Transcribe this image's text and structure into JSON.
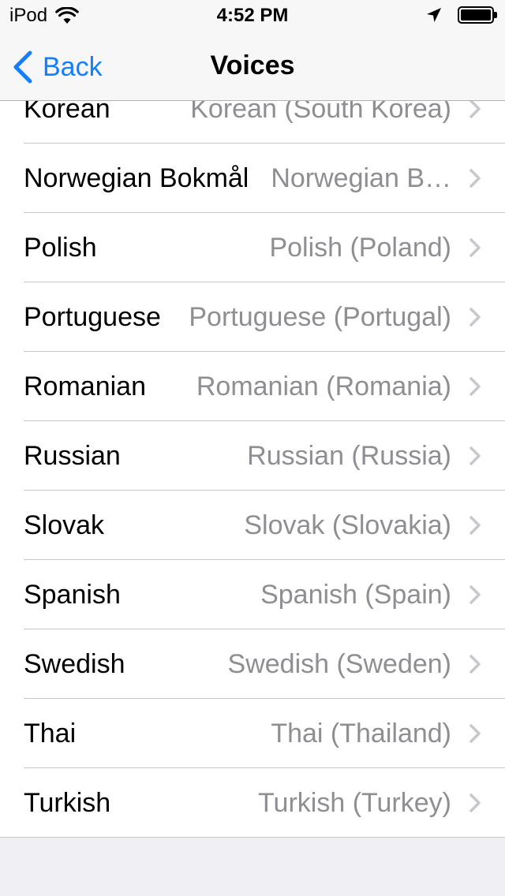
{
  "status_bar": {
    "carrier": "iPod",
    "time": "4:52 PM",
    "icons": [
      "wifi-icon",
      "location-arrow-icon",
      "battery-icon"
    ]
  },
  "nav": {
    "back_label": "Back",
    "title": "Voices"
  },
  "colors": {
    "accent": "#157efb",
    "detail_text": "#8e8e93",
    "background": "#efeff4"
  },
  "voices": [
    {
      "language": "Korean",
      "voice": "Korean (South Korea)"
    },
    {
      "language": "Norwegian Bokmål",
      "voice": "Norwegian B…"
    },
    {
      "language": "Polish",
      "voice": "Polish (Poland)"
    },
    {
      "language": "Portuguese",
      "voice": "Portuguese (Portugal)"
    },
    {
      "language": "Romanian",
      "voice": "Romanian (Romania)"
    },
    {
      "language": "Russian",
      "voice": "Russian (Russia)"
    },
    {
      "language": "Slovak",
      "voice": "Slovak (Slovakia)"
    },
    {
      "language": "Spanish",
      "voice": "Spanish (Spain)"
    },
    {
      "language": "Swedish",
      "voice": "Swedish (Sweden)"
    },
    {
      "language": "Thai",
      "voice": "Thai (Thailand)"
    },
    {
      "language": "Turkish",
      "voice": "Turkish (Turkey)"
    }
  ]
}
